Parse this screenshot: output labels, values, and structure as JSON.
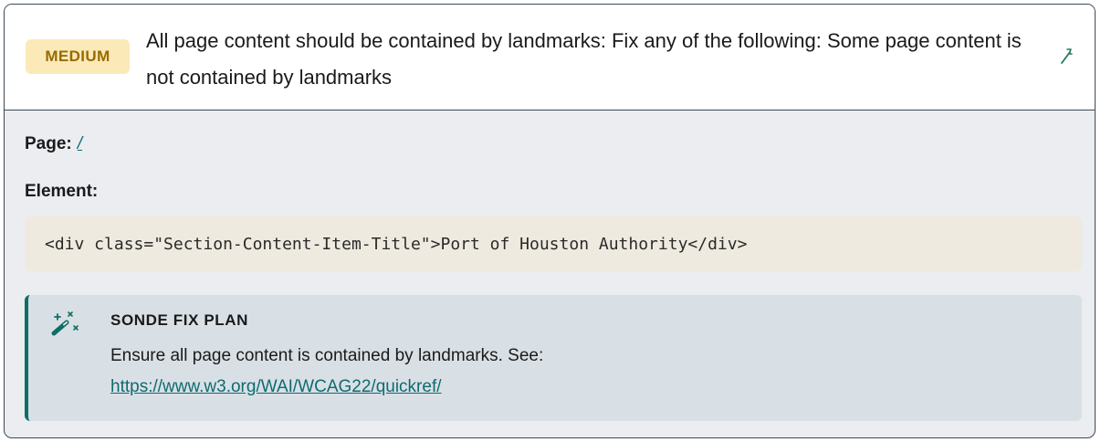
{
  "issue": {
    "severity_label": "MEDIUM",
    "title": "All page content should be contained by landmarks: Fix any of the following: Some page content is not contained by landmarks"
  },
  "details": {
    "page_label": "Page:",
    "page_value": "/",
    "element_label": "Element:",
    "element_code": "<div class=\"Section-Content-Item-Title\">Port of Houston Authority</div>"
  },
  "fix_plan": {
    "heading": "SONDE FIX PLAN",
    "text": "Ensure all page content is contained by landmarks. See:",
    "link": "https://www.w3.org/WAI/WCAG22/quickref/"
  },
  "colors": {
    "badge_bg": "#fbeab8",
    "badge_text": "#9a6a00",
    "accent": "#0f6e66",
    "link": "#0e6b6f"
  },
  "icons": {
    "expand": "wand-lightning-icon",
    "fix_plan": "magic-wand-icon"
  }
}
